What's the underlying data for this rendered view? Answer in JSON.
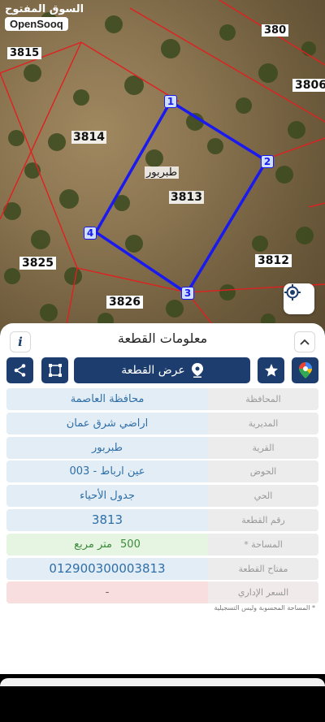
{
  "brand": {
    "arabic": "السوق المفتوح",
    "latin": "OpenSooq"
  },
  "map": {
    "parcel_labels": [
      "3815",
      "3814",
      "3806",
      "3813",
      "3825",
      "3812",
      "3826",
      "380"
    ],
    "vertex_labels": [
      "1",
      "2",
      "3",
      "4"
    ],
    "area_name": "طبربور",
    "colors": {
      "parcel_outline": "#1a1af0",
      "boundaries": "#e02020"
    }
  },
  "sheet": {
    "title": "معلومات القطعة",
    "view_button_label": "عرض القطعة",
    "info_icon_label": "i",
    "rows": [
      {
        "label": "المحافظة",
        "value": "محافظة العاصمة"
      },
      {
        "label": "المديرية",
        "value": "اراضي شرق عمان"
      },
      {
        "label": "القرية",
        "value": "طبربور"
      },
      {
        "label": "الحوض",
        "value": "عين ارباط - 003"
      },
      {
        "label": "الحي",
        "value": "جدول الأحياء"
      },
      {
        "label": "رقم القطعة",
        "value": "3813"
      },
      {
        "label": "المساحة *",
        "value": "500",
        "unit": "متر مربع"
      },
      {
        "label": "مفتاح القطعة",
        "value": "012900300003813"
      },
      {
        "label": "السعر الإداري",
        "value": "-"
      }
    ],
    "footnote": "* المساحة المحسوبة وليس التسجيلية"
  },
  "colors": {
    "accent": "#1c3d6e",
    "value_blue": "#2f6fa6",
    "area_green": "#e6f5e1",
    "price_red": "#f9dedf"
  }
}
